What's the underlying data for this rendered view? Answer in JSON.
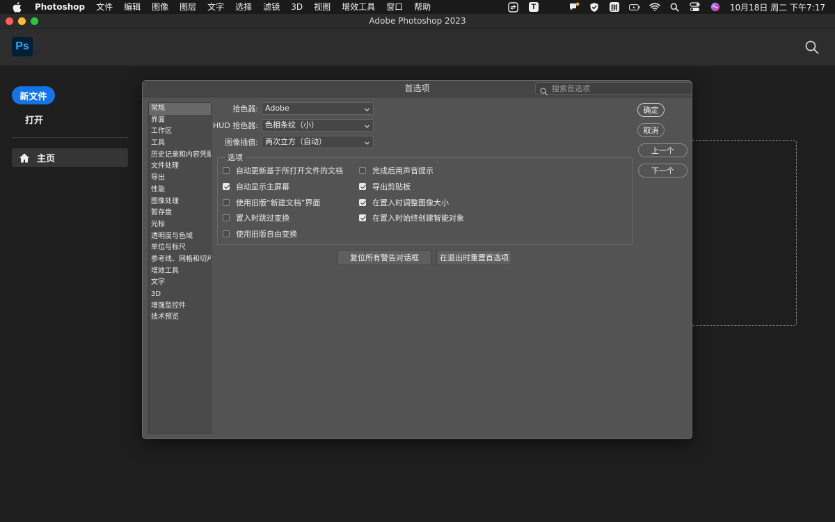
{
  "menubar": {
    "app_name": "Photoshop",
    "items": [
      "文件",
      "编辑",
      "图像",
      "图层",
      "文字",
      "选择",
      "滤镜",
      "3D",
      "视图",
      "增效工具",
      "窗口",
      "帮助"
    ],
    "tray_icons": [
      "sync-icon",
      "text-t-icon",
      "half-moon-icon",
      "notification-icon",
      "shield-icon",
      "pinyin-input-icon",
      "battery-icon",
      "wifi-icon",
      "spotlight-icon",
      "control-center-icon",
      "siri-icon"
    ],
    "input_method_label": "拼",
    "text_icon_label": "T",
    "clock": "10月18日 周二 下午7:17"
  },
  "window": {
    "title": "Adobe Photoshop 2023"
  },
  "ps_header": {
    "logo_text": "Ps"
  },
  "home": {
    "new_file_label": "新文件",
    "open_label": "打开",
    "nav_home_label": "主页"
  },
  "dialog": {
    "title": "首选项",
    "search_placeholder": "搜索首选项",
    "categories": [
      "常规",
      "界面",
      "工作区",
      "工具",
      "历史记录和内容凭据",
      "文件处理",
      "导出",
      "性能",
      "图像处理",
      "暂存盘",
      "光标",
      "透明度与色域",
      "单位与标尺",
      "参考线、网格和切片",
      "增效工具",
      "文字",
      "3D",
      "增强型控件",
      "技术预览"
    ],
    "selected_category": "常规",
    "fields": {
      "color_picker": {
        "label": "拾色器:",
        "value": "Adobe"
      },
      "hud_color_picker": {
        "label": "HUD 拾色器:",
        "value": "色相条纹（小）"
      },
      "image_interpolation": {
        "label": "图像插值:",
        "value": "两次立方（自动）"
      }
    },
    "options_title": "选项",
    "options_left": [
      {
        "label": "自动更新基于所打开文件的文档",
        "checked": false
      },
      {
        "label": "自动显示主屏幕",
        "checked": true
      },
      {
        "label": "使用旧版“新建文档”界面",
        "checked": false
      },
      {
        "label": "置入时跳过变换",
        "checked": false
      },
      {
        "label": "使用旧版自由变换",
        "checked": false
      }
    ],
    "options_right": [
      {
        "label": "完成后用声音提示",
        "checked": false
      },
      {
        "label": "导出剪贴板",
        "checked": true
      },
      {
        "label": "在置入时调整图像大小",
        "checked": true
      },
      {
        "label": "在置入时始终创建智能对象",
        "checked": true
      }
    ],
    "reset_warnings_label": "复位所有警告对话框",
    "reset_prefs_label": "在退出时重置首选项",
    "buttons": {
      "ok": "确定",
      "cancel": "取消",
      "prev": "上一个",
      "next": "下一个"
    }
  },
  "colors": {
    "accent_blue": "#1473e6",
    "ps_logo_bg": "#001e36",
    "ps_logo_fg": "#31a8ff",
    "dialog_bg": "#535353"
  }
}
